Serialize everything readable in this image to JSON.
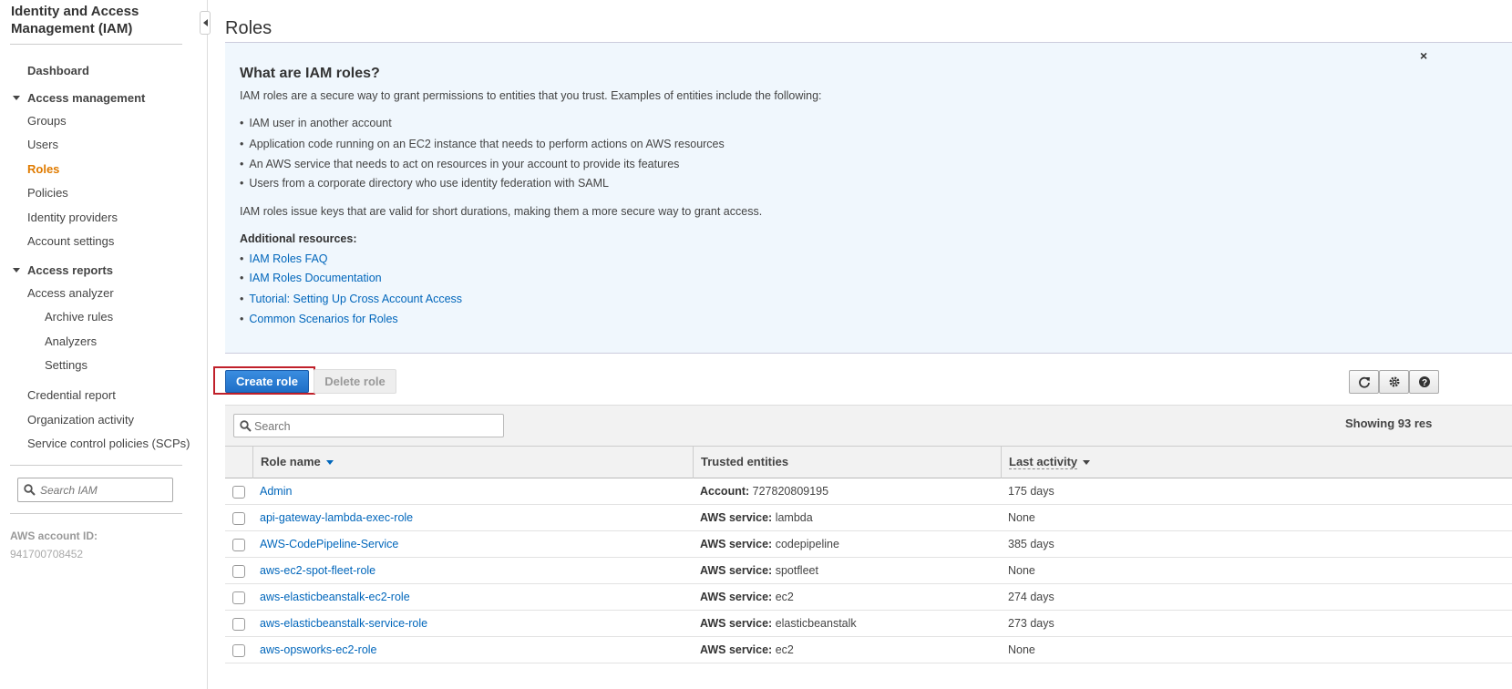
{
  "sidebar": {
    "title": "Identity and Access Management (IAM)",
    "dashboard": "Dashboard",
    "access_management": "Access management",
    "groups": "Groups",
    "users": "Users",
    "roles": "Roles",
    "policies": "Policies",
    "identity_providers": "Identity providers",
    "account_settings": "Account settings",
    "access_reports": "Access reports",
    "access_analyzer": "Access analyzer",
    "archive_rules": "Archive rules",
    "analyzers": "Analyzers",
    "settings": "Settings",
    "credential_report": "Credential report",
    "organization_activity": "Organization activity",
    "scps": "Service control policies (SCPs)",
    "search_placeholder": "Search IAM",
    "account_id_label": "AWS account ID:",
    "account_id": "941700708452"
  },
  "page": {
    "title": "Roles"
  },
  "info": {
    "heading": "What are IAM roles?",
    "intro": "IAM roles are a secure way to grant permissions to entities that you trust. Examples of entities include the following:",
    "examples": [
      "IAM user in another account",
      "Application code running on an EC2 instance that needs to perform actions on AWS resources",
      "An AWS service that needs to act on resources in your account to provide its features",
      "Users from a corporate directory who use identity federation with SAML"
    ],
    "keys_note": "IAM roles issue keys that are valid for short durations, making them a more secure way to grant access.",
    "resources_title": "Additional resources:",
    "resources": [
      "IAM Roles FAQ",
      "IAM Roles Documentation",
      "Tutorial: Setting Up Cross Account Access",
      "Common Scenarios for Roles"
    ],
    "close": "×"
  },
  "actions": {
    "create": "Create role",
    "delete": "Delete role"
  },
  "table": {
    "search_placeholder": "Search",
    "showing": "Showing 93 res",
    "columns": {
      "name": "Role name",
      "trusted": "Trusted entities",
      "activity": "Last activity"
    },
    "rows": [
      {
        "name": "Admin",
        "trust_label": "Account:",
        "trust_value": "727820809195",
        "activity": "175 days"
      },
      {
        "name": "api-gateway-lambda-exec-role",
        "trust_label": "AWS service:",
        "trust_value": "lambda",
        "activity": "None"
      },
      {
        "name": "AWS-CodePipeline-Service",
        "trust_label": "AWS service:",
        "trust_value": "codepipeline",
        "activity": "385 days"
      },
      {
        "name": "aws-ec2-spot-fleet-role",
        "trust_label": "AWS service:",
        "trust_value": "spotfleet",
        "activity": "None"
      },
      {
        "name": "aws-elasticbeanstalk-ec2-role",
        "trust_label": "AWS service:",
        "trust_value": "ec2",
        "activity": "274 days"
      },
      {
        "name": "aws-elasticbeanstalk-service-role",
        "trust_label": "AWS service:",
        "trust_value": "elasticbeanstalk",
        "activity": "273 days"
      },
      {
        "name": "aws-opsworks-ec2-role",
        "trust_label": "AWS service:",
        "trust_value": "ec2",
        "activity": "None"
      }
    ]
  },
  "colors": {
    "link": "#0066bb",
    "active_nav": "#e07b00",
    "primary_button": "#1f6fc7",
    "highlight_outline": "#c0202a",
    "info_bg": "#f0f7fd"
  }
}
